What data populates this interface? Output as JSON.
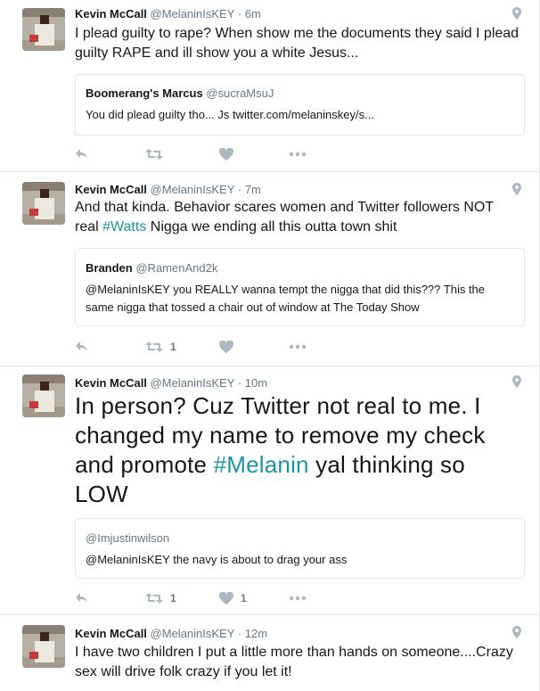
{
  "tweets": [
    {
      "name": "Kevin McCall",
      "handle": "@MelaninIsKEY",
      "time": "6m",
      "text_parts": [
        "I plead guilty to rape? When show me the documents they said I plead guilty RAPE and ill show you a white Jesus..."
      ],
      "quote": {
        "name": "Boomerang's Marcus",
        "handle": "@sucraMsuJ",
        "text": "You did plead guilty tho... Js twitter.com/melaninskey/s..."
      },
      "retweets": "",
      "likes": ""
    },
    {
      "name": "Kevin McCall",
      "handle": "@MelaninIsKEY",
      "time": "7m",
      "text_before": "And that kinda. Behavior scares women and Twitter followers NOT real ",
      "hashtag": "#Watts",
      "text_after": " Nigga we ending all this outta town shit",
      "quote": {
        "name": "Branden",
        "handle": "@RamenAnd2k",
        "text": "@MelaninIsKEY you REALLY wanna tempt the nigga that did this??? This the same nigga that tossed a chair out of window at The Today Show"
      },
      "retweets": "1",
      "likes": ""
    },
    {
      "name": "Kevin McCall",
      "handle": "@MelaninIsKEY",
      "time": "10m",
      "text_before": "In person? Cuz Twitter not real to me. I changed my name to remove my check and promote ",
      "hashtag": "#Melanin",
      "text_after": " yal thinking so LOW",
      "quote": {
        "name": "",
        "handle": "@Imjustinwilson",
        "text": "@MelaninIsKEY the navy is about to drag your ass"
      },
      "retweets": "1",
      "likes": "1"
    },
    {
      "name": "Kevin McCall",
      "handle": "@MelaninIsKEY",
      "time": "12m",
      "text_parts": [
        "I have two children I put a little more than hands on someone....Crazy sex will drive folk crazy if you let it!"
      ]
    }
  ],
  "icons": {
    "reply": "reply-icon",
    "retweet": "retweet-icon",
    "like": "heart-icon",
    "more": "more-icon",
    "geo": "location-pin-icon"
  },
  "colors": {
    "hashtag": "#1b95a0",
    "muted": "#657786",
    "border": "#e1e8ed",
    "icon": "#aab8c2"
  }
}
